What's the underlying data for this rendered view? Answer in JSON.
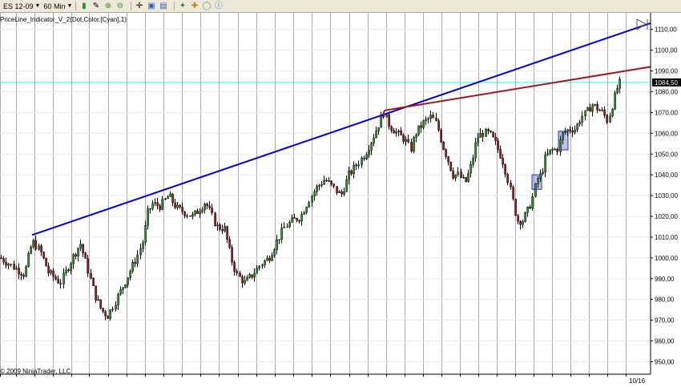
{
  "toolbar": {
    "instrument": "ES 12-09",
    "interval": "60 Min",
    "icons": [
      "bar-type-icon",
      "pen-icon",
      "zoom-in-icon",
      "zoom-out-icon",
      "crosshair-icon",
      "chart-properties-icon",
      "data-box-icon",
      "strategy-icon",
      "indicator-icon",
      "ellipse-icon",
      "info-icon"
    ]
  },
  "chart_data": {
    "type": "candlestick",
    "indicator_label": "PriceLine_Indicator_V_2(Dot,Color.[Cyan],1)",
    "copyright": "© 2009 NinjaTrader, LLC",
    "ylim": [
      944,
      1118
    ],
    "y_ticks": [
      "950,00",
      "960,00",
      "970,00",
      "980,00",
      "990,00",
      "1000,00",
      "1010,00",
      "1020,00",
      "1030,00",
      "1040,00",
      "1050,00",
      "1060,00",
      "1070,00",
      "1080,00",
      "1090,00",
      "1100,00",
      "1110,00"
    ],
    "x_tick_labels": [
      "10/16"
    ],
    "price_line": {
      "value": 1084.5,
      "label": "1084,50",
      "color": "#00ffff"
    },
    "colors": {
      "up": "#2e8b2e",
      "down": "#a01818",
      "outline": "#000000",
      "blue_trend": "#0000cc",
      "red_trend": "#9b1a1a",
      "grid": "#aaaaaa",
      "box": "#7070e0"
    },
    "price_path": [
      [
        0,
        1000
      ],
      [
        15,
        996
      ],
      [
        30,
        992
      ],
      [
        40,
        1008
      ],
      [
        50,
        1003
      ],
      [
        60,
        993
      ],
      [
        75,
        988
      ],
      [
        90,
        1000
      ],
      [
        100,
        1007
      ],
      [
        108,
        996
      ],
      [
        118,
        982
      ],
      [
        126,
        975
      ],
      [
        134,
        972
      ],
      [
        142,
        978
      ],
      [
        150,
        984
      ],
      [
        160,
        992
      ],
      [
        170,
        1000
      ],
      [
        178,
        1008
      ],
      [
        184,
        1022
      ],
      [
        190,
        1026
      ],
      [
        200,
        1025
      ],
      [
        210,
        1030
      ],
      [
        220,
        1024
      ],
      [
        230,
        1022
      ],
      [
        240,
        1020
      ],
      [
        250,
        1024
      ],
      [
        256,
        1027
      ],
      [
        262,
        1022
      ],
      [
        270,
        1015
      ],
      [
        280,
        1014
      ],
      [
        288,
        1000
      ],
      [
        295,
        992
      ],
      [
        305,
        988
      ],
      [
        315,
        992
      ],
      [
        325,
        997
      ],
      [
        335,
        1000
      ],
      [
        345,
        1008
      ],
      [
        355,
        1015
      ],
      [
        365,
        1018
      ],
      [
        375,
        1020
      ],
      [
        385,
        1028
      ],
      [
        395,
        1034
      ],
      [
        405,
        1038
      ],
      [
        415,
        1034
      ],
      [
        425,
        1030
      ],
      [
        435,
        1040
      ],
      [
        445,
        1045
      ],
      [
        455,
        1050
      ],
      [
        465,
        1058
      ],
      [
        472,
        1064
      ],
      [
        478,
        1070
      ],
      [
        485,
        1064
      ],
      [
        495,
        1060
      ],
      [
        505,
        1057
      ],
      [
        512,
        1052
      ],
      [
        518,
        1060
      ],
      [
        528,
        1065
      ],
      [
        538,
        1068
      ],
      [
        545,
        1064
      ],
      [
        552,
        1054
      ],
      [
        558,
        1048
      ],
      [
        565,
        1040
      ],
      [
        572,
        1040
      ],
      [
        580,
        1036
      ],
      [
        588,
        1045
      ],
      [
        595,
        1058
      ],
      [
        602,
        1060
      ],
      [
        610,
        1060
      ],
      [
        618,
        1055
      ],
      [
        626,
        1048
      ],
      [
        632,
        1040
      ],
      [
        638,
        1030
      ],
      [
        645,
        1018
      ],
      [
        652,
        1018
      ],
      [
        660,
        1024
      ],
      [
        665,
        1030
      ],
      [
        670,
        1038
      ],
      [
        675,
        1040
      ],
      [
        680,
        1048
      ],
      [
        688,
        1052
      ],
      [
        695,
        1052
      ],
      [
        702,
        1060
      ],
      [
        710,
        1062
      ],
      [
        718,
        1062
      ],
      [
        725,
        1068
      ],
      [
        732,
        1070
      ],
      [
        738,
        1074
      ],
      [
        745,
        1072
      ],
      [
        752,
        1070
      ],
      [
        758,
        1066
      ],
      [
        764,
        1074
      ],
      [
        770,
        1082
      ],
      [
        774,
        1085
      ]
    ],
    "trendlines": [
      {
        "color": "blue_trend",
        "from": [
          40,
          1011
        ],
        "to": [
          812,
          1113
        ]
      },
      {
        "color": "red_trend",
        "from": [
          480,
          1071
        ],
        "to": [
          812,
          1092
        ]
      },
      {
        "color": "red_trend",
        "from": [
          478,
          1069
        ],
        "to": [
          480,
          1071
        ]
      }
    ],
    "boxes": [
      {
        "x1": 664,
        "x2": 676,
        "y1": 1033,
        "y2": 1040
      },
      {
        "x1": 697,
        "x2": 709,
        "y1": 1052,
        "y2": 1061
      }
    ],
    "session_lines_x": [
      0,
      20,
      43,
      66,
      89,
      111,
      135,
      158,
      181,
      204,
      227,
      250,
      273,
      297,
      320,
      343,
      366,
      389,
      412,
      436,
      459,
      482,
      505,
      528,
      551,
      574,
      597,
      620,
      643,
      666,
      689,
      712,
      735,
      758,
      781
    ]
  }
}
